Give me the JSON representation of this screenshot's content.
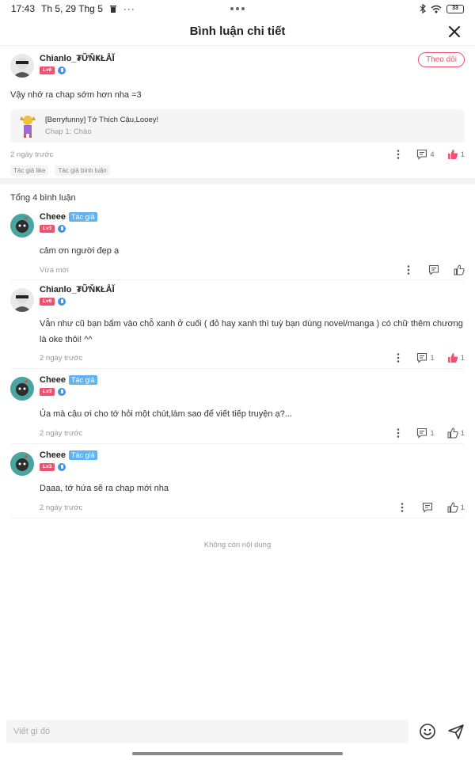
{
  "status_bar": {
    "time": "17:43",
    "date": "Th 5, 29 Thg 5",
    "battery": "33"
  },
  "header": {
    "title": "Bình luận chi tiết"
  },
  "top_comment": {
    "username": "Chianlo_₮ỮŇҜŁÅĬ",
    "level": "Lv6",
    "follow_label": "Theo dõi",
    "text": "Vậy nhớ ra chap sớm hơn nha =3",
    "story": {
      "title": "[Berryfunny] Tớ Thích Cậu,Looey!",
      "chapter": "Chap 1: Chào"
    },
    "time": "2 ngày trước",
    "comment_count": "4",
    "like_count": "1",
    "chips": [
      "Tác giả like",
      "Tác giả bình luận"
    ]
  },
  "total_label": "Tổng 4 bình luận",
  "replies": [
    {
      "username": "Cheee",
      "author_tag": "Tác giả",
      "level": "Lv3",
      "text": "cảm ơn người đẹp ạ",
      "time": "Vừa mới",
      "comment_count": "",
      "like_count": ""
    },
    {
      "username": "Chianlo_₮ỮŇҜŁÅĬ",
      "author_tag": "",
      "level": "Lv6",
      "text": "Vẫn như cũ bạn bấm vào chỗ xanh ở cuối ( đỏ hay xanh thì tuỳ bạn dùng novel/manga ) có chữ thêm chương là oke thôi! ^^",
      "time": "2 ngày trước",
      "comment_count": "1",
      "like_count": "1"
    },
    {
      "username": "Cheee",
      "author_tag": "Tác giả",
      "level": "Lv3",
      "text": "Ủa mà cậu ơi cho tớ hỏi một chút,làm sao để viết tiếp truyện ạ?...",
      "time": "2 ngày trước",
      "comment_count": "1",
      "like_count": "1"
    },
    {
      "username": "Cheee",
      "author_tag": "Tác giả",
      "level": "Lv3",
      "text": "Dạaa, tớ hứa sẽ ra chap mới nha",
      "time": "2 ngày trước",
      "comment_count": "",
      "like_count": "1"
    }
  ],
  "end_label": "Không còn nội dung",
  "input": {
    "placeholder": "Viết gì đó"
  },
  "colors": {
    "accent": "#f0506e",
    "author_tag": "#5fb3f3",
    "liked": "#f0506e"
  }
}
